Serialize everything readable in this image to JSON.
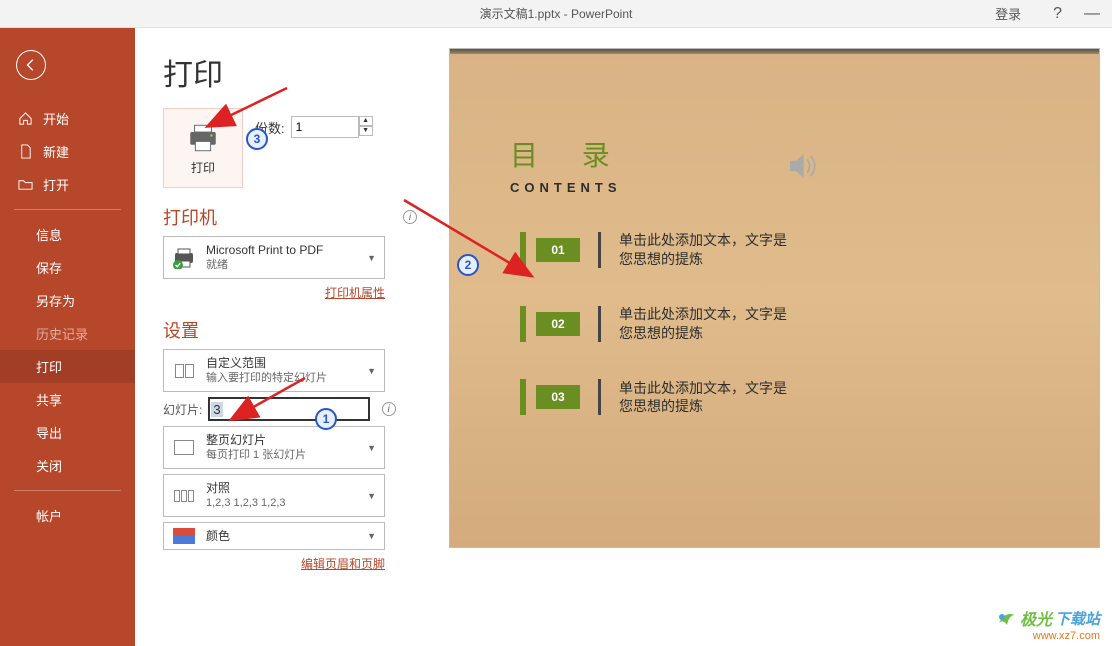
{
  "titlebar": {
    "title": "演示文稿1.pptx  -  PowerPoint",
    "login": "登录",
    "help": "?"
  },
  "sidebar": {
    "start": "开始",
    "new": "新建",
    "open": "打开",
    "info": "信息",
    "save": "保存",
    "saveas": "另存为",
    "history": "历史记录",
    "print": "打印",
    "share": "共享",
    "export": "导出",
    "close": "关闭",
    "account": "帐户"
  },
  "print": {
    "heading": "打印",
    "button": "打印",
    "copies_label": "份数:",
    "copies_value": "1"
  },
  "printer": {
    "section": "打印机",
    "name": "Microsoft Print to PDF",
    "status": "就绪",
    "props": "打印机属性"
  },
  "settings": {
    "section": "设置",
    "range_l1": "自定义范围",
    "range_l2": "输入要打印的特定幻灯片",
    "slide_label": "幻灯片:",
    "slide_value": "3",
    "layout_l1": "整页幻灯片",
    "layout_l2": "每页打印 1 张幻灯片",
    "collate_l1": "对照",
    "collate_l2": "1,2,3    1,2,3    1,2,3",
    "color": "颜色",
    "footer": "编辑页眉和页脚"
  },
  "slide": {
    "title": "目 录",
    "subtitle": "CONTENTS",
    "items": [
      {
        "num": "01",
        "text1": "单击此处添加文本，文字是",
        "text2": "您思想的提炼"
      },
      {
        "num": "02",
        "text1": "单击此处添加文本，文字是",
        "text2": "您思想的提炼"
      },
      {
        "num": "03",
        "text1": "单击此处添加文本，文字是",
        "text2": "您思想的提炼"
      }
    ]
  },
  "watermark": {
    "line1a": "极光",
    "line1b": "下载站",
    "line2": "www.xz7.com"
  }
}
